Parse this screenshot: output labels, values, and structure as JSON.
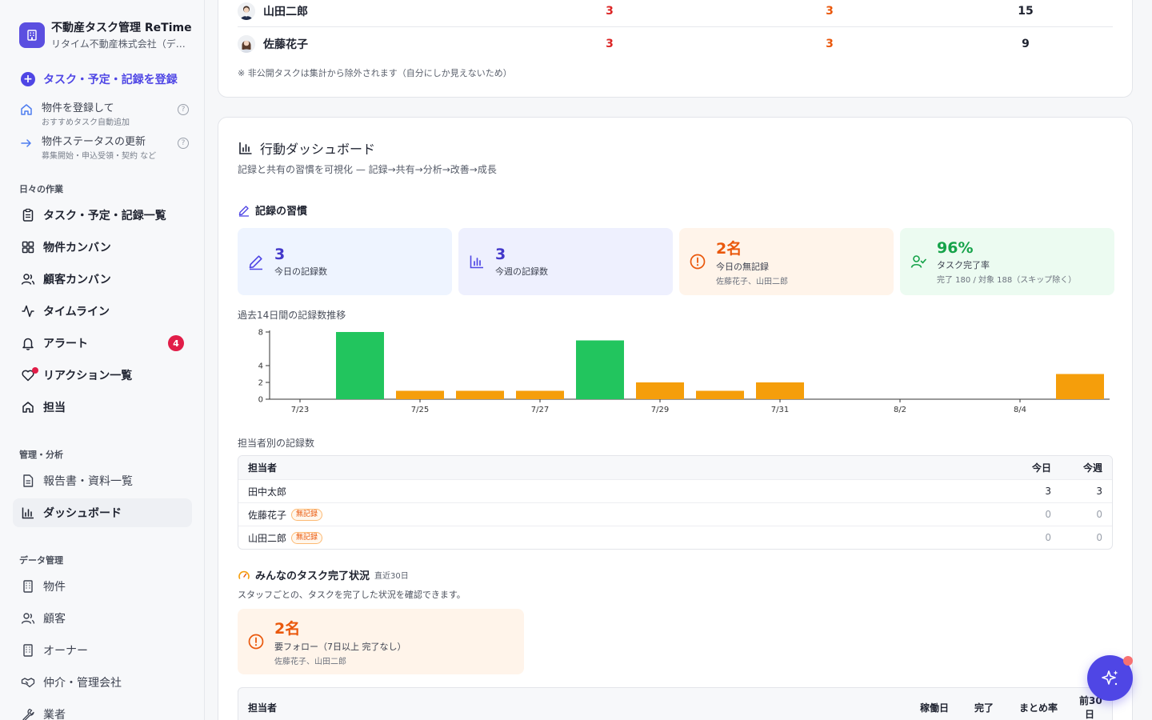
{
  "app": {
    "title": "不動産タスク管理 ReTime",
    "company": "リタイム不動産株式会社（デモ）"
  },
  "sidebar": {
    "register_label": "タスク・予定・記録を登録",
    "quick": [
      {
        "title": "物件を登録して",
        "sub": "おすすめタスク自動追加",
        "icon": "home-icon"
      },
      {
        "title": "物件ステータスの更新",
        "sub": "募集開始・申込受領・契約 など",
        "icon": "arrow-right-icon"
      }
    ],
    "help_glyph": "?",
    "sections": {
      "daily": "日々の作業",
      "manage": "管理・分析",
      "data": "データ管理"
    },
    "daily_items": [
      {
        "label": "タスク・予定・記録一覧",
        "icon": "clipboard-icon"
      },
      {
        "label": "物件カンバン",
        "icon": "grid-icon"
      },
      {
        "label": "顧客カンバン",
        "icon": "users-icon"
      },
      {
        "label": "タイムライン",
        "icon": "activity-icon"
      },
      {
        "label": "アラート",
        "icon": "bell-icon",
        "badge": "4"
      },
      {
        "label": "リアクション一覧",
        "icon": "heart-icon"
      },
      {
        "label": "担当",
        "icon": "home-icon"
      }
    ],
    "manage_items": [
      {
        "label": "報告書・資料一覧",
        "icon": "file-icon"
      },
      {
        "label": "ダッシュボード",
        "icon": "bar-chart-icon"
      }
    ],
    "data_items": [
      {
        "label": "物件",
        "icon": "building-icon"
      },
      {
        "label": "顧客",
        "icon": "users-icon"
      },
      {
        "label": "オーナー",
        "icon": "building-icon"
      },
      {
        "label": "仲介・管理会社",
        "icon": "handshake-icon"
      },
      {
        "label": "業者",
        "icon": "tool-icon"
      }
    ]
  },
  "top_table": {
    "rows": [
      {
        "name": "山田二郎",
        "a": "3",
        "b": "3",
        "c": "15"
      },
      {
        "name": "佐藤花子",
        "a": "3",
        "b": "3",
        "c": "9"
      }
    ],
    "note": "※ 非公開タスクは集計から除外されます（自分にしか見えないため）",
    "colors": {
      "a": "#dc2626",
      "b": "#ea580c"
    }
  },
  "dashboard": {
    "title": "行動ダッシュボード",
    "subtitle": "記録と共有の習慣を可視化 — 記録→共有→分析→改善→成長",
    "habit_title": "記録の習慣",
    "stats": [
      {
        "value": "3",
        "label": "今日の記録数",
        "sub": "",
        "color": "#4338ca",
        "bg": "#eef4ff",
        "icon": "pencil-icon"
      },
      {
        "value": "3",
        "label": "今週の記録数",
        "sub": "",
        "color": "#4338ca",
        "bg": "#eef0fe",
        "icon": "bar-chart-icon"
      },
      {
        "value": "2名",
        "label": "今日の無記録",
        "sub": "佐藤花子、山田二郎",
        "color": "#ea580c",
        "bg": "#fff4ea",
        "icon": "alert-circle-icon"
      },
      {
        "value": "96%",
        "label": "タスク完了率",
        "sub": "完了 180 / 対象 188（スキップ除く）",
        "color": "#16a34a",
        "bg": "#ecfbf1",
        "icon": "user-check-icon"
      }
    ],
    "chart_label": "過去14日間の記録数推移",
    "staff_label": "担当者別の記録数",
    "staff_table": {
      "headers": {
        "name": "担当者",
        "today": "今日",
        "week": "今週"
      },
      "rows": [
        {
          "name": "田中太郎",
          "today": "3",
          "week": "3",
          "tag": ""
        },
        {
          "name": "佐藤花子",
          "today": "0",
          "week": "0",
          "tag": "無記録"
        },
        {
          "name": "山田二郎",
          "today": "0",
          "week": "0",
          "tag": "無記録"
        }
      ]
    },
    "completion": {
      "title": "みんなのタスク完了状況",
      "period": "直近30日",
      "desc": "スタッフごとの、タスクを完了した状況を確認できます。",
      "follow_value": "2名",
      "follow_label": "要フォロー（7日以上 完了なし）",
      "follow_sub": "佐藤花子、山田二郎",
      "headers": {
        "name": "担当者",
        "days": "稼働日",
        "done": "完了",
        "rate": "まとめ率",
        "prev1": "前30",
        "prev2": "日"
      }
    }
  },
  "chart_data": {
    "type": "bar",
    "categories": [
      "7/23",
      "7/24",
      "7/25",
      "7/26",
      "7/27",
      "7/28",
      "7/29",
      "7/30",
      "7/31",
      "8/1",
      "8/2",
      "8/3",
      "8/4",
      "8/5"
    ],
    "values": [
      0,
      8,
      1,
      1,
      1,
      7,
      2,
      1,
      2,
      0,
      0,
      0,
      0,
      3
    ],
    "x_tick_labels": [
      "7/23",
      "7/25",
      "7/27",
      "7/29",
      "7/31",
      "8/2",
      "8/4"
    ],
    "y_ticks": [
      0,
      2,
      4,
      8
    ],
    "ylim": [
      0,
      8
    ],
    "title": "過去14日間の記録数推移",
    "colors": {
      "high": "#22c55e",
      "low": "#f59e0b"
    },
    "grid": false
  }
}
